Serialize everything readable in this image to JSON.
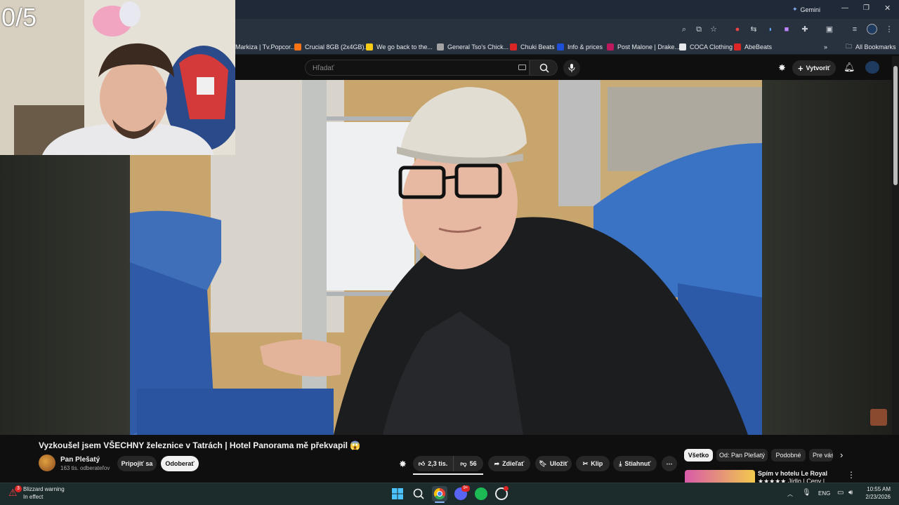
{
  "browser": {
    "gemini_label": "Gemini",
    "bookmarks": [
      {
        "label": "Markiza | Tv.Popcor...",
        "color": "#3b82f6"
      },
      {
        "label": "Crucial 8GB (2x4GB)...",
        "color": "#f97316"
      },
      {
        "label": "We go back to the...",
        "color": "#facc15"
      },
      {
        "label": "General Tso's Chick...",
        "color": "#a3a3a3"
      },
      {
        "label": "Chuki Beats",
        "color": "#dc2626"
      },
      {
        "label": "Info & prices",
        "color": "#1d4ed8"
      },
      {
        "label": "Post Malone | Drake...",
        "color": "#be185d"
      },
      {
        "label": "COCA Clothing",
        "color": "#e5e7eb"
      },
      {
        "label": "AbeBeats",
        "color": "#dc2626"
      }
    ],
    "all_bookmarks": "All Bookmarks"
  },
  "youtube": {
    "search_placeholder": "Hľadať",
    "create_label": "Vytvoriť",
    "video_title": "Vyzkoušel jsem VŠECHNY železnice v Tatrách | Hotel Panorama mě překvapil 😱",
    "channel_name": "Pan Plešatý",
    "channel_subs": "163 tis. odberateľov",
    "join_label": "Pripojiť sa",
    "subscribe_label": "Odoberať",
    "likes": "2,3 tis.",
    "dislikes": "56",
    "share_label": "Zdieľať",
    "save_label": "Uložiť",
    "clip_label": "Klip",
    "download_label": "Stiahnuť",
    "chips": [
      "Všetko",
      "Od: Pan Plešatý",
      "Podobné",
      "Pre vás"
    ],
    "rec_title": "Spím v hotelu Le Royal",
    "rec_sub": "★★★★★ Jídlo | Ceny |"
  },
  "overlay": {
    "counter": "0/5"
  },
  "taskbar": {
    "weather_title": "Blizzard warning",
    "weather_sub": "In effect",
    "weather_badge": "3",
    "lang": "ENG",
    "time": "10:55 AM",
    "date": "2/23/2026",
    "discord_badge": "9+"
  },
  "colors": {
    "yt_bg": "#0f0f0f",
    "subscribe_bg": "#f1f1f1",
    "taskbar_bg": "#1c2b2b"
  }
}
